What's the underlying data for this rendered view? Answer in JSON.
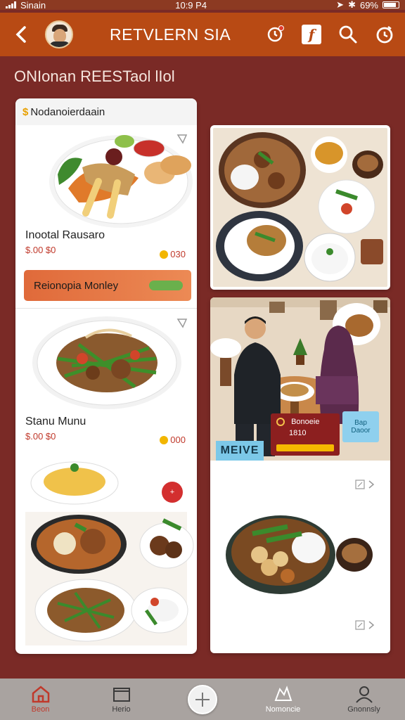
{
  "status_bar": {
    "carrier": "Sinain",
    "time": "10:9 P4",
    "battery_percent": "69%"
  },
  "header": {
    "title": "RETVLERN SIA",
    "icons": [
      "back-icon",
      "avatar",
      "notification-icon",
      "brand-icon",
      "search-icon",
      "timer-icon"
    ],
    "brand_letter": "f"
  },
  "page": {
    "title": "ONIonan REESTaol lIol"
  },
  "left_card": {
    "header": "Nodanoierdaain",
    "items": [
      {
        "name": "Inootal Rausaro",
        "price": "$.00 $0",
        "badge": "030"
      },
      {
        "name": "Stanu Munu",
        "price": "$.00 $0",
        "badge": "000"
      }
    ],
    "cta_label": "Reionopia  Monley",
    "fab_label": "+"
  },
  "right_bottom_card": {
    "promo_title": "Bonoeie",
    "promo_value": "1810",
    "chip_line1": "Bap",
    "chip_line2": "Daoor",
    "menu_tag": "MEIVE"
  },
  "bottom_nav": {
    "items": [
      {
        "label": "Beon",
        "icon": "home-icon",
        "active": true
      },
      {
        "label": "Herio",
        "icon": "folder-icon",
        "active": false
      },
      {
        "label": "",
        "icon": "add-icon",
        "active": false
      },
      {
        "label": "Nomoncie",
        "icon": "map-icon",
        "active": false
      },
      {
        "label": "Gnonnsly",
        "icon": "profile-icon",
        "active": false
      }
    ]
  },
  "colors": {
    "background": "#7a2a26",
    "header": "#b84a14",
    "price": "#c0392b",
    "cta": "#e06a3a",
    "nav": "#a9a3a0"
  }
}
